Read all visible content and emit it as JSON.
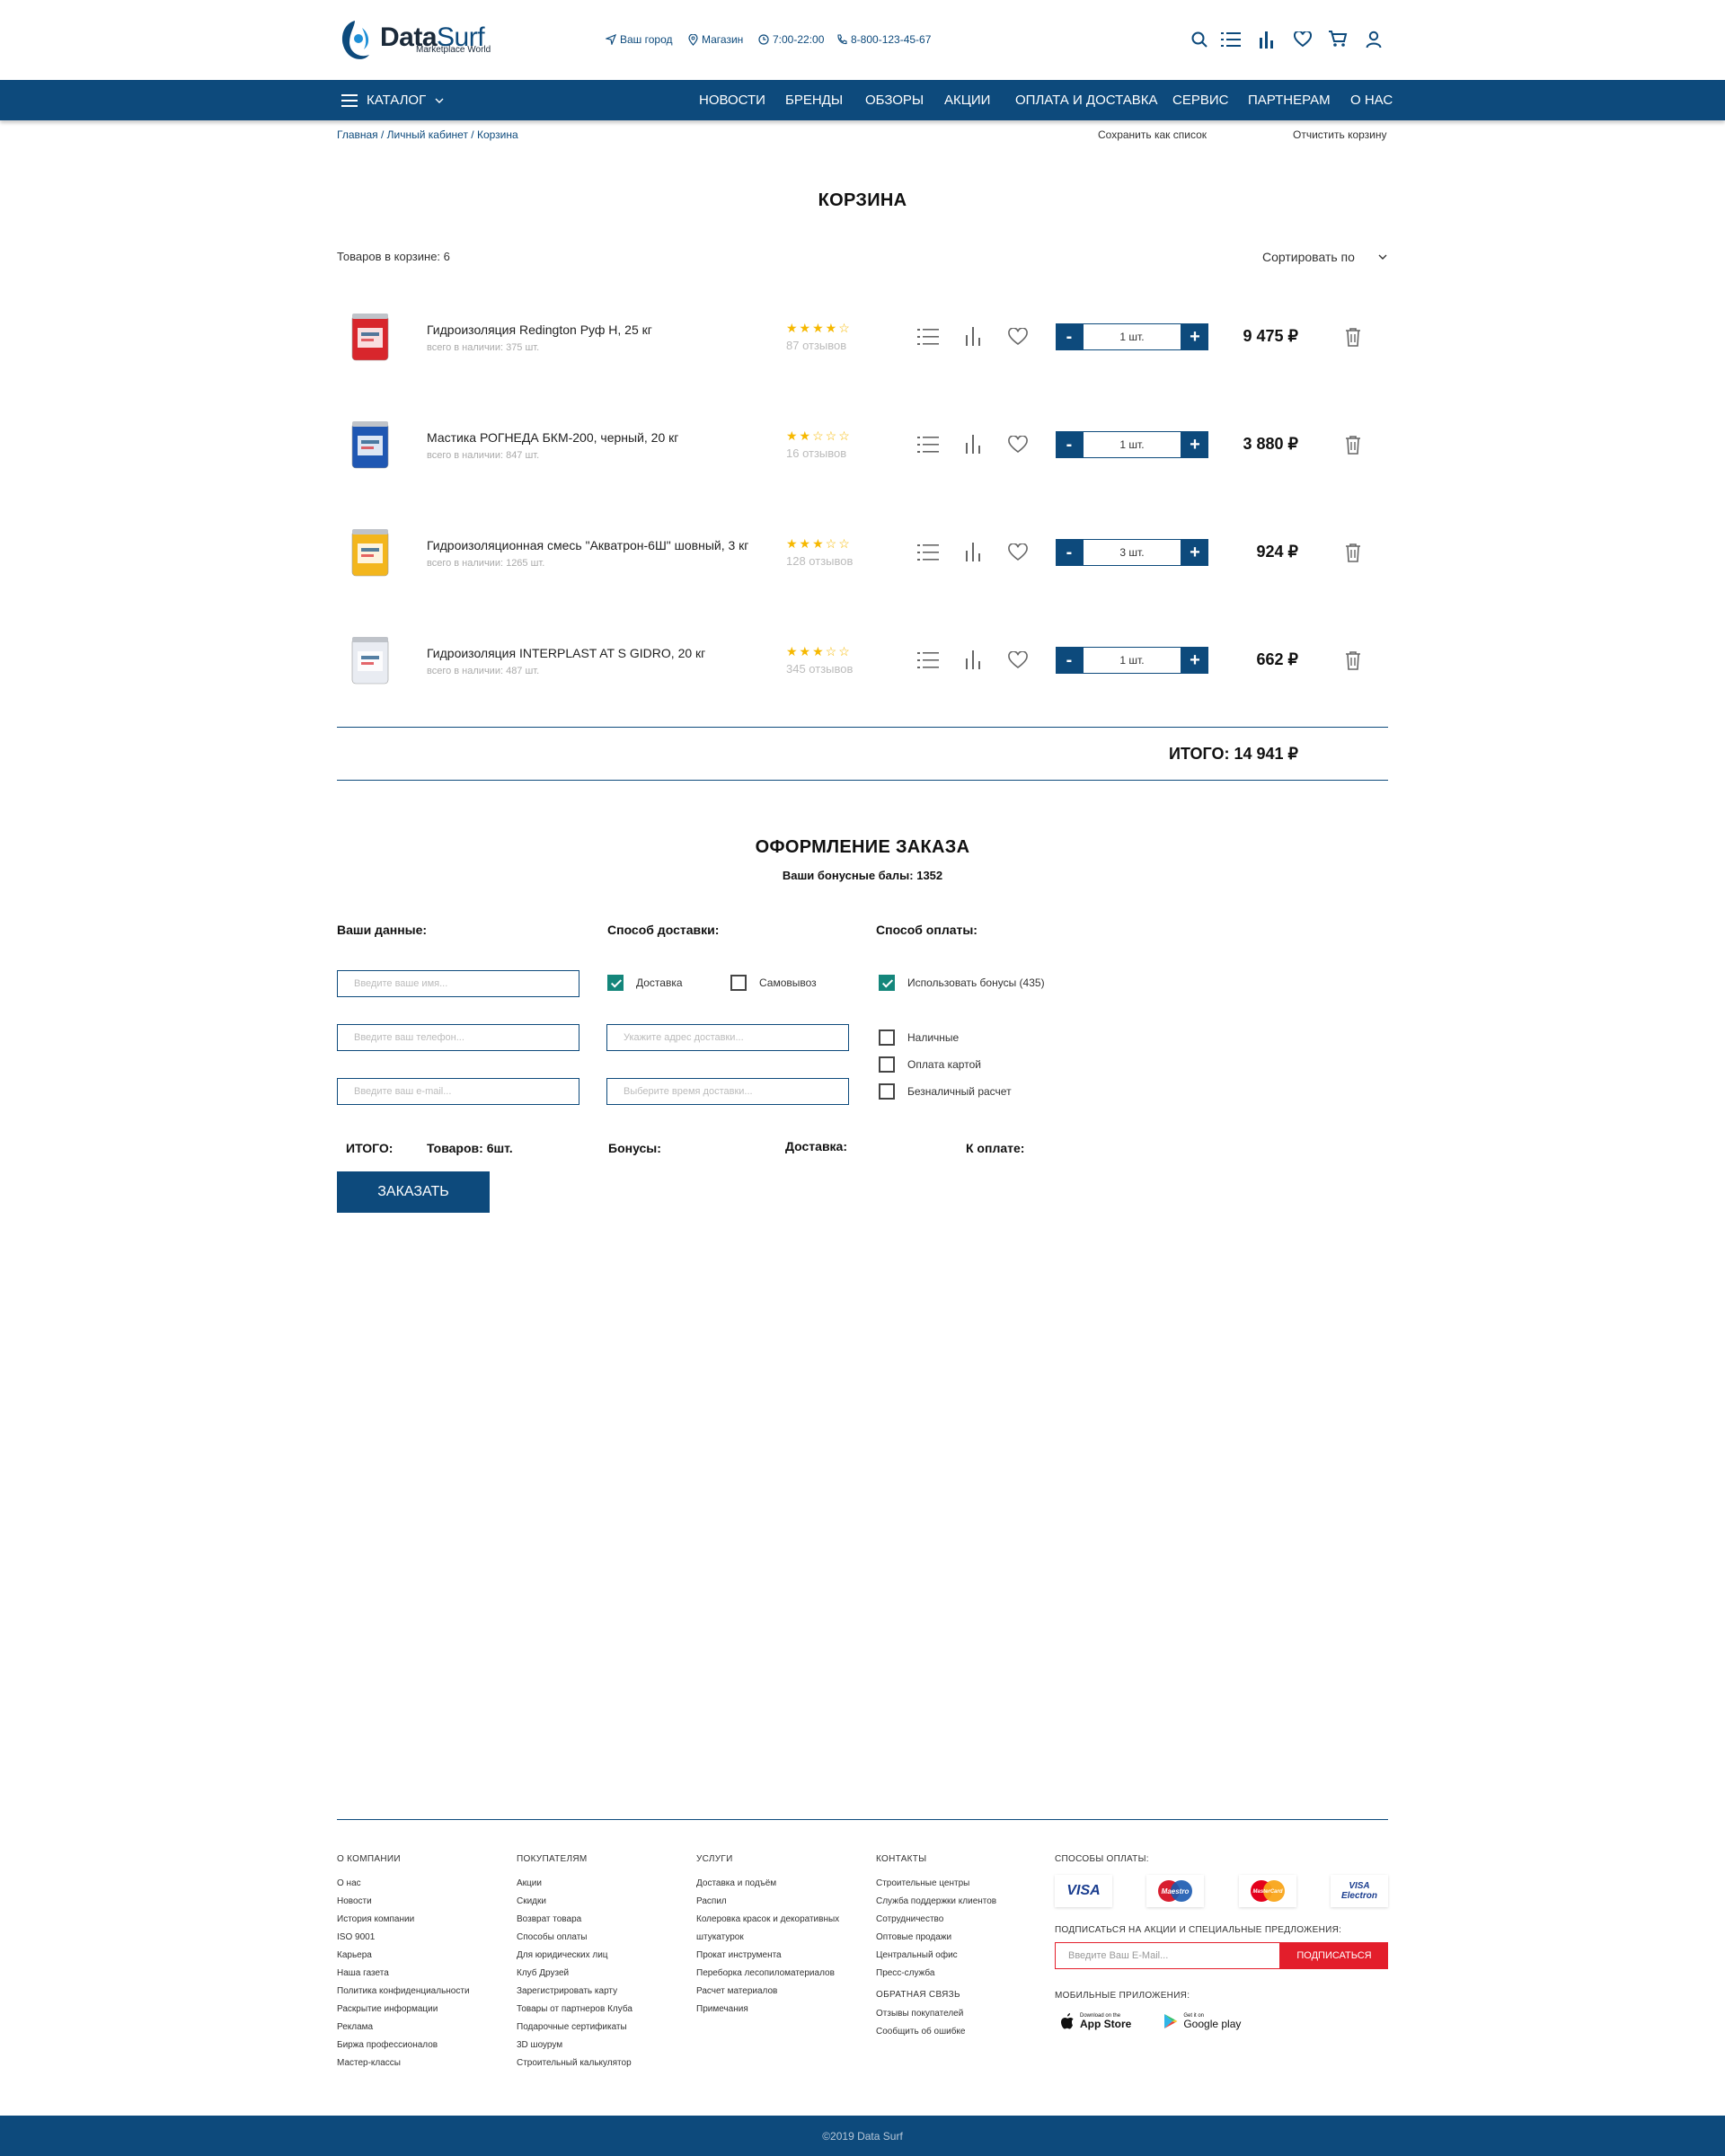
{
  "header": {
    "logo_main": "Data",
    "logo_accent": "Surf",
    "logo_sub": "Marketplace World",
    "city": "Ваш город",
    "shop": "Магазин",
    "hours": "7:00-22:00",
    "phone": "8-800-123-45-67"
  },
  "nav": {
    "catalog": "КАТАЛОГ",
    "items": [
      "НОВОСТИ",
      "БРЕНДЫ",
      "ОБЗОРЫ",
      "АКЦИИ",
      "ОПЛАТА И ДОСТАВКА",
      "СЕРВИС",
      "ПАРТНЕРАМ",
      "О НАС"
    ]
  },
  "breadcrumb": "Главная / Личный кабинет / Корзина",
  "actions": {
    "save_list": "Сохранить как список",
    "clear_cart": "Отчистить корзину"
  },
  "cart": {
    "title": "КОРЗИНА",
    "count_label": "Товаров в корзине: 6",
    "sort_label": "Сортировать по",
    "items": [
      {
        "name": "Гидроизоляция Redington Руф Н, 25 кг",
        "stock": "всего в наличии: 375 шт.",
        "rating": 4,
        "reviews": "87 отзывов",
        "qty": "1 шт.",
        "price": "9 475 ₽",
        "img_color": "#d8262c"
      },
      {
        "name": "Мастика РОГНЕДА БКМ-200, черный, 20 кг",
        "stock": "всего в наличии: 847 шт.",
        "rating": 2,
        "reviews": "16 отзывов",
        "qty": "1 шт.",
        "price": "3 880 ₽",
        "img_color": "#1f57b3"
      },
      {
        "name": "Гидроизоляционная смесь \"Акватрон-6Ш\" шовный, 3 кг",
        "stock": "всего в наличии: 1265 шт.",
        "rating": 3,
        "reviews": "128 отзывов",
        "qty": "3 шт.",
        "price": "924 ₽",
        "img_color": "#f3b61d"
      },
      {
        "name": "Гидроизоляция INTERPLAST AT S GIDRO,  20 кг",
        "stock": "всего в наличии: 487 шт.",
        "rating": 3,
        "reviews": "345 отзывов",
        "qty": "1 шт.",
        "price": "662 ₽",
        "img_color": "#e9ecf2"
      }
    ],
    "total": "ИТОГО: 14 941 ₽"
  },
  "checkout": {
    "title": "ОФОРМЛЕНИЕ ЗАКАЗА",
    "bonus": "Ваши бонусные балы: 1352",
    "your_data": "Ваши данные:",
    "delivery_method": "Способ доставки:",
    "payment_method": "Способ оплаты:",
    "name_ph": "Введите ваше имя...",
    "phone_ph": "Введите ваш телефон...",
    "email_ph": "Введите ваш e-mail...",
    "address_ph": "Укажите адрес доставки...",
    "time_ph": "Выберите время доставки...",
    "opt_delivery": "Доставка",
    "opt_pickup": "Самовывоз",
    "opt_bonus": "Использовать бонусы (435)",
    "opt_cash": "Наличные",
    "opt_card": "Оплата картой",
    "opt_cashless": "Безналичный расчет",
    "sum_total": "ИТОГО:",
    "sum_items": "Товаров: 6шт.",
    "sum_bonus": "Бонусы:",
    "sum_delivery": "Доставка:",
    "sum_pay": "К оплате:",
    "order_btn": "ЗАКАЗАТЬ"
  },
  "footer": {
    "col1": {
      "title": "О КОМПАНИИ",
      "links": [
        "О нас",
        "Новости",
        "История компании",
        "ISO 9001",
        "Карьера",
        "Наша газета",
        "Политика конфиденциальности",
        "Раскрытие информации",
        "Реклама",
        "Биржа профессионалов",
        "Мастер-классы"
      ]
    },
    "col2": {
      "title": "ПОКУПАТЕЛЯМ",
      "links": [
        "Акции",
        "Скидки",
        "Возврат товара",
        "Способы оплаты",
        "Для юридических лиц",
        "Клуб Друзей",
        "Зарегистрировать карту",
        "Товары от партнеров Клуба",
        "Подарочные сертификаты",
        "3D шоурум",
        "Строительный калькулятор"
      ]
    },
    "col3": {
      "title": "УСЛУГИ",
      "links": [
        "Доставка и подъём",
        "Распил",
        "Колеровка красок и  декоративных",
        "штукатурок",
        "Прокат инструмента",
        "Переборка лесопиломатериалов",
        "Расчет материалов",
        "Примечания"
      ]
    },
    "col4": {
      "title": "КОНТАКТЫ",
      "links": [
        "Строительные центры",
        "Служба поддержки клиентов",
        "Сотрудничество",
        "Оптовые продажи",
        "Центральный офис",
        "Пресс-служба"
      ],
      "feedback_title": "ОБРАТНАЯ СВЯЗЬ",
      "feedback_links": [
        "Отзывы покупателей",
        "Сообщить об ошибке"
      ]
    },
    "pay_title": "СПОСОБЫ ОПЛАТЫ:",
    "pay_cards": [
      "VISA",
      "Maestro",
      "MasterCard",
      "VISA Electron"
    ],
    "subscribe_title": "ПОДПИСАТЬСЯ НА АКЦИИ И СПЕЦИАЛЬНЫЕ ПРЕДЛОЖЕНИЯ:",
    "subscribe_ph": "Введите Ваш E-Mail...",
    "subscribe_btn": "ПОДПИСАТЬСЯ",
    "apps_title": "МОБИЛЬНЫЕ ПРИЛОЖЕНИЯ:",
    "appstore_small": "Download on the",
    "appstore_big": "App Store",
    "gplay_small": "Get it on",
    "gplay_big": "Google play",
    "copyright": "©2019  Data Surf"
  },
  "colors": {
    "brand": "#0d4a7c",
    "accent_red": "#e31e2b",
    "check_green": "#14867b",
    "star": "#f6b800"
  }
}
